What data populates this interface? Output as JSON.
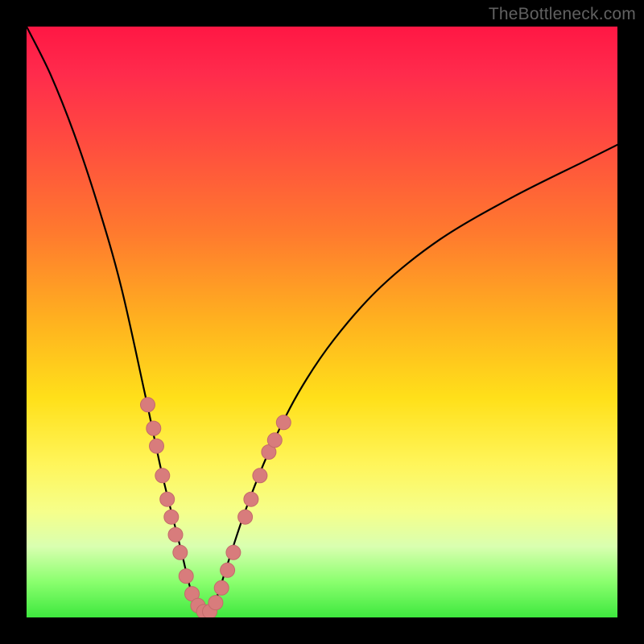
{
  "watermark": "TheBottleneck.com",
  "colors": {
    "curve": "#000000",
    "marker_fill": "#d87c7c",
    "marker_stroke": "#c46a6a",
    "gradient_top": "#ff1744",
    "gradient_bottom": "#3ee83e",
    "frame": "#000000"
  },
  "chart_data": {
    "type": "line",
    "title": "",
    "xlabel": "",
    "ylabel": "",
    "xlim": [
      0,
      100
    ],
    "ylim": [
      0,
      100
    ],
    "note": "x in percent across plot width, y in percent bottleneck (0 = ideal at bottom, 100 = worst at top). Minimum of the V is near x≈30.",
    "series": [
      {
        "name": "bottleneck-curve",
        "x": [
          0,
          4,
          8,
          12,
          16,
          20,
          23,
          26,
          28,
          30,
          32,
          34,
          37,
          41,
          46,
          52,
          60,
          70,
          82,
          94,
          100
        ],
        "y": [
          100,
          92,
          82,
          70,
          56,
          38,
          24,
          12,
          4,
          0.5,
          3,
          9,
          18,
          28,
          38,
          47,
          56,
          64,
          71,
          77,
          80
        ]
      }
    ],
    "markers": {
      "name": "highlighted-points",
      "note": "pink dots clustered on the lower arms of the V",
      "points": [
        {
          "x": 20.5,
          "y": 36
        },
        {
          "x": 21.5,
          "y": 32
        },
        {
          "x": 22.0,
          "y": 29
        },
        {
          "x": 23.0,
          "y": 24
        },
        {
          "x": 23.8,
          "y": 20
        },
        {
          "x": 24.5,
          "y": 17
        },
        {
          "x": 25.2,
          "y": 14
        },
        {
          "x": 26.0,
          "y": 11
        },
        {
          "x": 27.0,
          "y": 7
        },
        {
          "x": 28.0,
          "y": 4
        },
        {
          "x": 29.0,
          "y": 2
        },
        {
          "x": 30.0,
          "y": 1
        },
        {
          "x": 31.0,
          "y": 1
        },
        {
          "x": 32.0,
          "y": 2.5
        },
        {
          "x": 33.0,
          "y": 5
        },
        {
          "x": 34.0,
          "y": 8
        },
        {
          "x": 35.0,
          "y": 11
        },
        {
          "x": 37.0,
          "y": 17
        },
        {
          "x": 38.0,
          "y": 20
        },
        {
          "x": 39.5,
          "y": 24
        },
        {
          "x": 41.0,
          "y": 28
        },
        {
          "x": 42.0,
          "y": 30
        },
        {
          "x": 43.5,
          "y": 33
        }
      ]
    }
  }
}
